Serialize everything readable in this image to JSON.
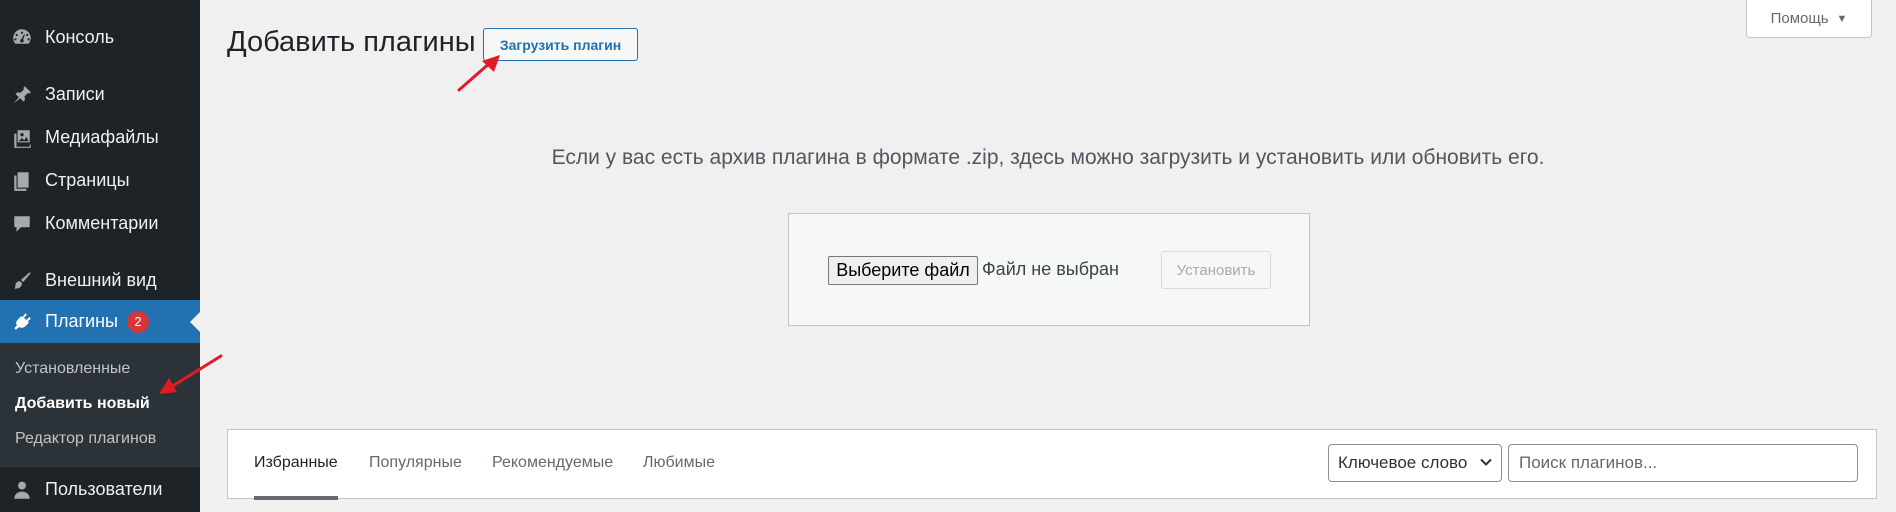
{
  "sidebar": {
    "items": [
      {
        "label": "Консоль",
        "icon": "dashboard-icon"
      },
      {
        "label": "Записи",
        "icon": "pin-icon"
      },
      {
        "label": "Медиафайлы",
        "icon": "media-icon"
      },
      {
        "label": "Страницы",
        "icon": "pages-icon"
      },
      {
        "label": "Комментарии",
        "icon": "comment-icon"
      },
      {
        "label": "Внешний вид",
        "icon": "brush-icon"
      },
      {
        "label": "Плагины",
        "icon": "plugin-icon",
        "badge": "2"
      },
      {
        "label": "Пользователи",
        "icon": "user-icon"
      }
    ],
    "submenu": [
      {
        "label": "Установленные"
      },
      {
        "label": "Добавить новый"
      },
      {
        "label": "Редактор плагинов"
      }
    ]
  },
  "header": {
    "help_label": "Помощь",
    "title": "Добавить плагины",
    "upload_label": "Загрузить плагин"
  },
  "upload": {
    "intro": "Если у вас есть архив плагина в формате .zip, здесь можно загрузить и установить или обновить его.",
    "choose_file_label": "Выберите файл",
    "file_status": "Файл не выбран",
    "install_label": "Установить"
  },
  "filters": {
    "tabs": [
      {
        "label": "Избранные"
      },
      {
        "label": "Популярные"
      },
      {
        "label": "Рекомендуемые"
      },
      {
        "label": "Любимые"
      }
    ],
    "search_type": "Ключевое слово",
    "search_placeholder": "Поиск плагинов..."
  },
  "colors": {
    "sidebar_bg": "#1d2327",
    "accent": "#2271b1",
    "badge": "#d63638",
    "annotation_arrow": "#e01b24"
  }
}
